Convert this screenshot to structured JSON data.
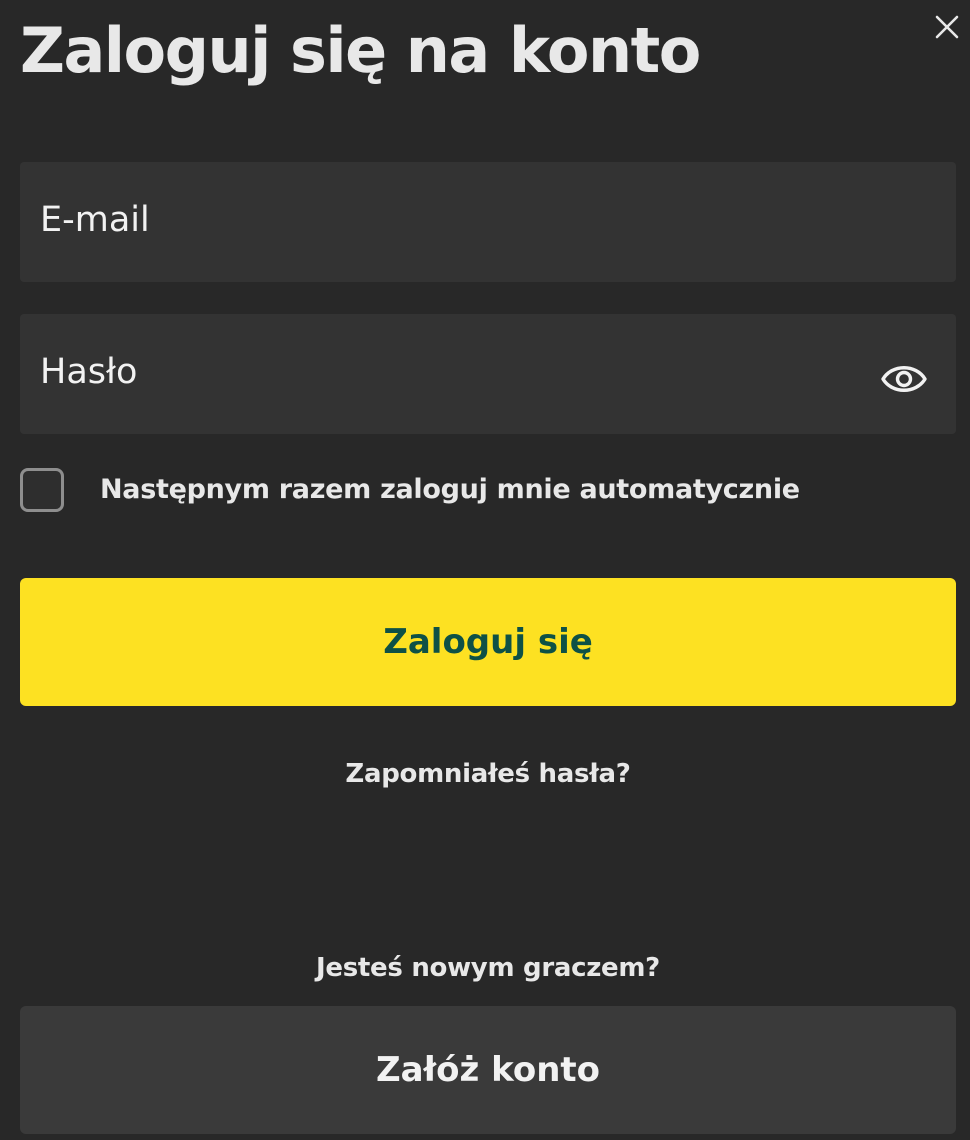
{
  "header": {
    "title": "Zaloguj się na konto",
    "close_icon": "close-icon"
  },
  "form": {
    "email_placeholder": "E-mail",
    "email_value": "",
    "password_placeholder": "Hasło",
    "password_value": "",
    "password_toggle_icon": "eye-icon",
    "remember_label": "Następnym razem zaloguj mnie automatycznie",
    "remember_checked": false,
    "login_label": "Zaloguj się",
    "forgot_label": "Zapomniałeś hasła?"
  },
  "register": {
    "prompt": "Jesteś nowym graczem?",
    "button_label": "Załóż konto"
  },
  "colors": {
    "background": "#282828",
    "field_background": "#333333",
    "primary_button": "#fde122",
    "primary_button_text": "#0e5146",
    "secondary_button": "#3a3a3a",
    "text": "#e8e8e8"
  }
}
